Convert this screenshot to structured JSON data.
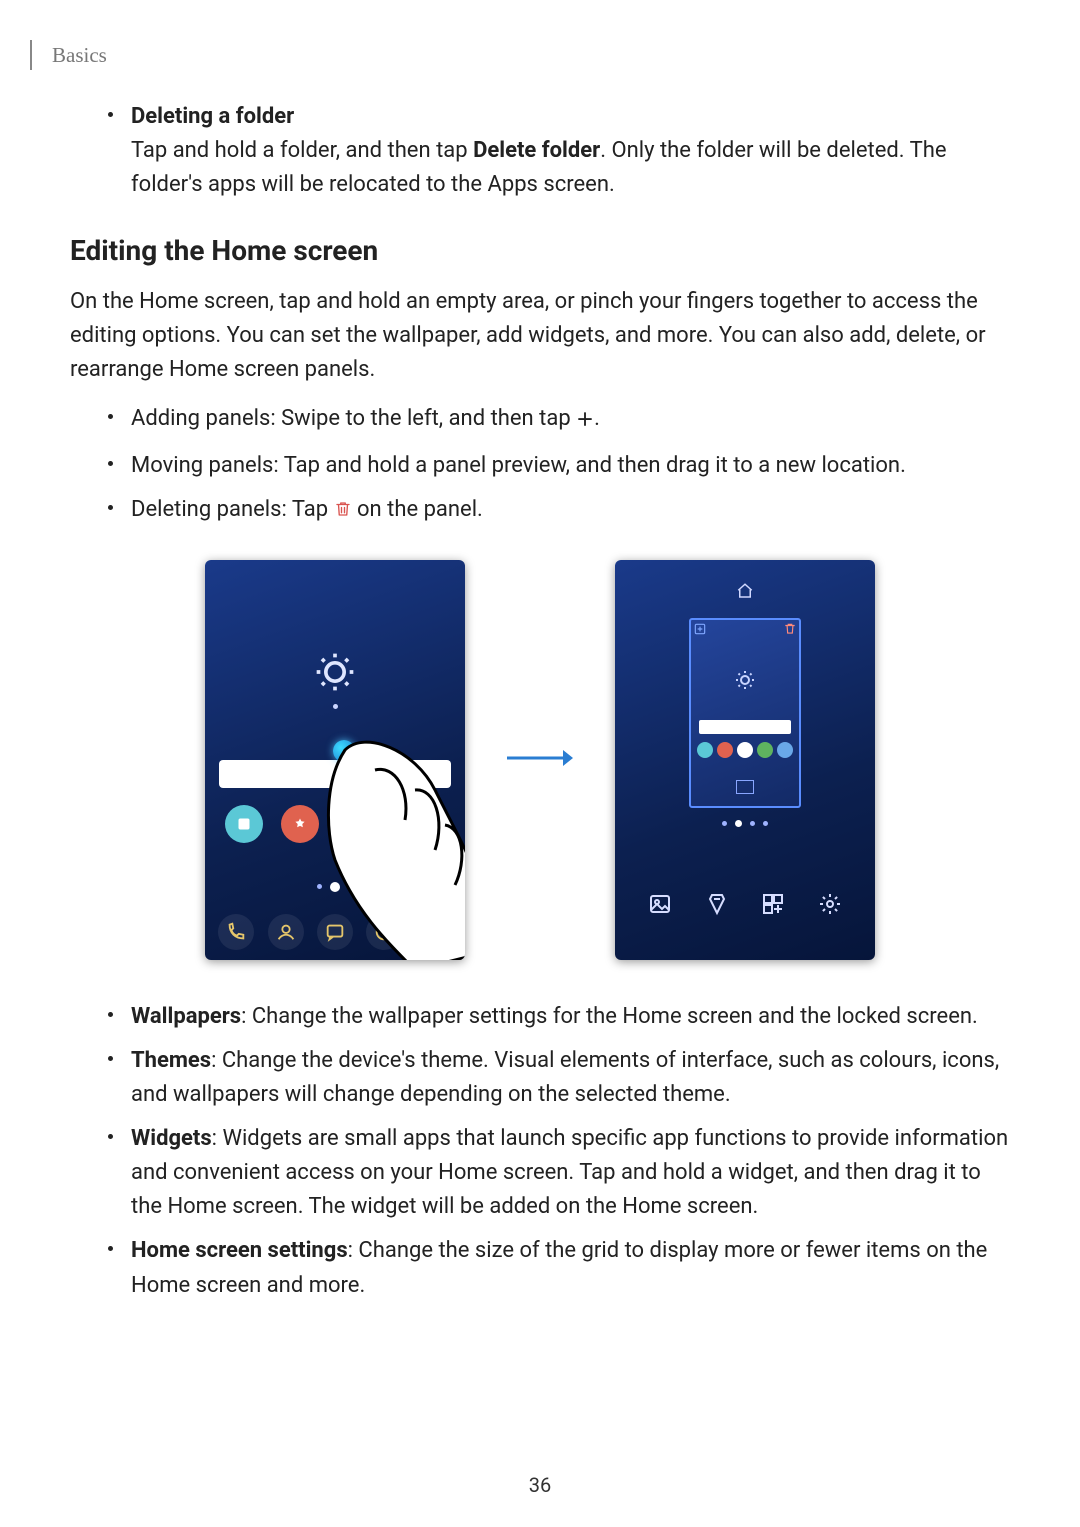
{
  "header": {
    "section": "Basics"
  },
  "delete_folder": {
    "title": "Deleting a folder",
    "body_1": "Tap and hold a folder, and then tap ",
    "bold_action": "Delete folder",
    "body_2": ". Only the folder will be deleted. The folder's apps will be relocated to the Apps screen."
  },
  "editing": {
    "heading": "Editing the Home screen",
    "intro": "On the Home screen, tap and hold an empty area, or pinch your fingers together to access the editing options. You can set the wallpaper, add widgets, and more. You can also add, delete, or rearrange Home screen panels.",
    "bullets": {
      "adding_pre": "Adding panels: Swipe to the left, and then tap ",
      "adding_post": ".",
      "moving": "Moving panels: Tap and hold a panel preview, and then drag it to a new location.",
      "deleting_pre": "Deleting panels: Tap ",
      "deleting_post": " on the panel."
    }
  },
  "options": {
    "wallpapers": {
      "label": "Wallpapers",
      "desc": ": Change the wallpaper settings for the Home screen and the locked screen."
    },
    "themes": {
      "label": "Themes",
      "desc": ": Change the device's theme. Visual elements of interface, such as colours, icons, and wallpapers will change depending on the selected theme."
    },
    "widgets": {
      "label": "Widgets",
      "desc": ": Widgets are small apps that launch specific app functions to provide information and convenient access on your Home screen. Tap and hold a widget, and then drag it to the Home screen. The widget will be added on the Home screen."
    },
    "home_settings": {
      "label": "Home screen settings",
      "desc": ": Change the size of the grid to display more or fewer items on the Home screen and more."
    }
  },
  "page_number": "36"
}
